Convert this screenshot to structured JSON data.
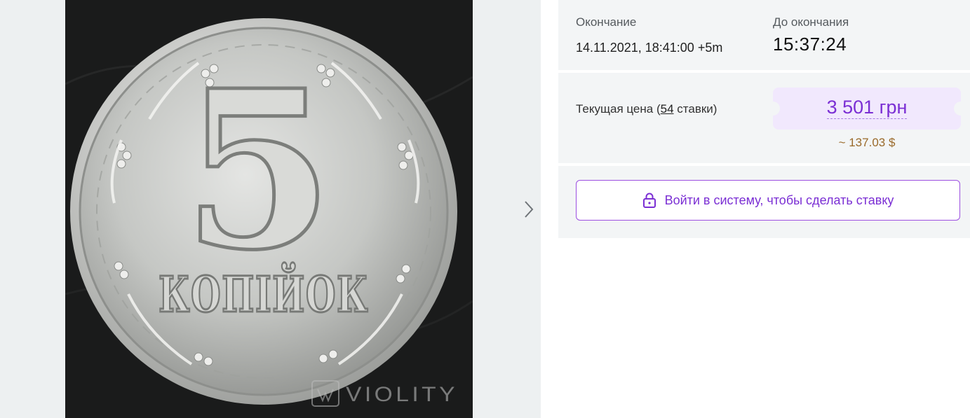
{
  "gallery": {
    "watermark": "VIOLITY",
    "coin_numeral": "5",
    "coin_text": "КОПІЙОК",
    "next_icon": "chevron-right-icon"
  },
  "auction": {
    "end_label": "Окончание",
    "end_value": "14.11.2021, 18:41:00 +5m",
    "time_left_label": "До окончания",
    "time_left_value": "15:37:24",
    "current_price_label": "Текущая цена",
    "bids_count": "54",
    "bids_word": "ставки",
    "price": "3 501 грн",
    "price_usd": "~ 137.03 $",
    "accent_color": "#7b2fd4"
  },
  "login": {
    "button_label": "Войти в систему, чтобы сделать ставку",
    "icon": "lock-icon"
  }
}
